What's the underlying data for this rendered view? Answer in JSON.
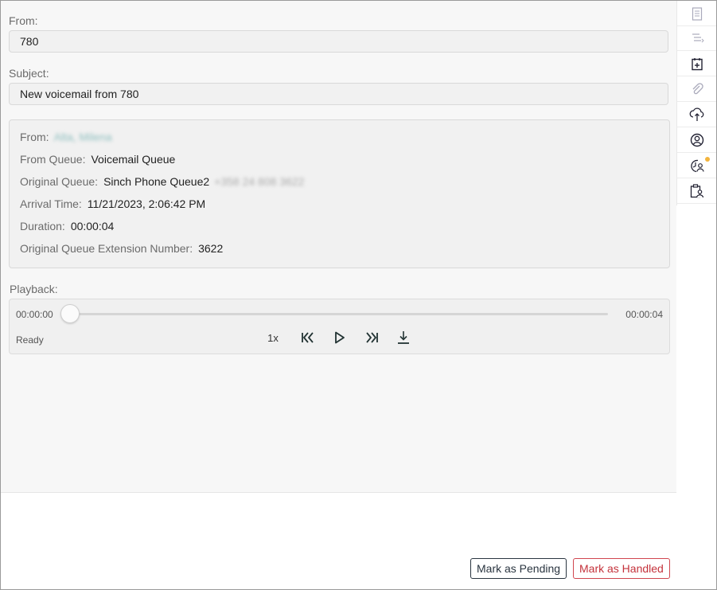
{
  "form": {
    "from_label": "From:",
    "from_value": "780",
    "subject_label": "Subject:",
    "subject_value": "New voicemail from 780"
  },
  "details": {
    "from_label": "From:",
    "from_value": "Alta, Milena",
    "from_queue_label": "From Queue:",
    "from_queue_value": "Voicemail Queue",
    "original_queue_label": "Original Queue:",
    "original_queue_value": "Sinch Phone Queue2",
    "original_queue_extra": "+358 24 808 3622",
    "arrival_label": "Arrival Time:",
    "arrival_value": "11/21/2023, 2:06:42 PM",
    "duration_label": "Duration:",
    "duration_value": "00:00:04",
    "extension_label": "Original Queue Extension Number:",
    "extension_value": "3622"
  },
  "playback": {
    "label": "Playback:",
    "current_time": "00:00:00",
    "total_time": "00:00:04",
    "progress": 0,
    "status": "Ready",
    "speed": "1x"
  },
  "sidebar": {
    "icons": [
      "notes-icon",
      "transcript-icon",
      "add-task-icon",
      "attachment-icon",
      "cloud-upload-icon",
      "contact-icon",
      "contact-history-icon",
      "case-contact-icon"
    ],
    "accent_dot_color": "#f3b43d"
  },
  "actions": {
    "pending_label": "Mark as Pending",
    "handled_label": "Mark as Handled"
  },
  "colors": {
    "handled_accent": "#c4323b",
    "pending_border": "#2a3540"
  }
}
